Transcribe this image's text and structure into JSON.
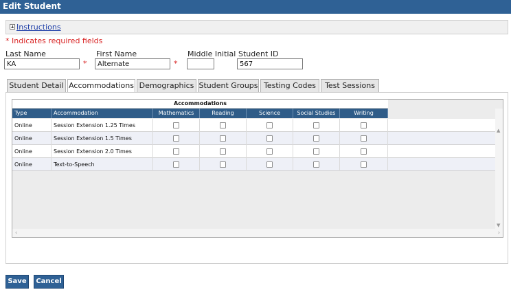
{
  "title": "Edit Student",
  "instructions": {
    "label": "Instructions"
  },
  "required_note": "* Indicates required fields",
  "fields": {
    "last_name": {
      "label": "Last Name",
      "value": "KA"
    },
    "first_name": {
      "label": "First Name",
      "value": "Alternate"
    },
    "middle_initial": {
      "label": "Middle Initial",
      "value": ""
    },
    "student_id": {
      "label": "Student ID",
      "value": "567"
    },
    "required_marker": "*"
  },
  "tabs": [
    {
      "label": "Student Detail",
      "active": false
    },
    {
      "label": "Accommodations",
      "active": true
    },
    {
      "label": "Demographics",
      "active": false
    },
    {
      "label": "Student Groups",
      "active": false
    },
    {
      "label": "Testing Codes",
      "active": false
    },
    {
      "label": "Test Sessions",
      "active": false
    }
  ],
  "grid": {
    "caption": "Accommodations",
    "columns": [
      "Type",
      "Accommodation",
      "Mathematics",
      "Reading",
      "Science",
      "Social Studies",
      "Writing"
    ],
    "rows": [
      {
        "type": "Online",
        "accommodation": "Session Extension 1.25 Times"
      },
      {
        "type": "Online",
        "accommodation": "Session Extension 1.5 Times"
      },
      {
        "type": "Online",
        "accommodation": "Session Extension 2.0 Times"
      },
      {
        "type": "Online",
        "accommodation": "Text-to-Speech"
      }
    ]
  },
  "buttons": {
    "save": "Save",
    "cancel": "Cancel"
  },
  "colors": {
    "header": "#2f6195",
    "required": "#d92525",
    "grid_header": "#2f5c88"
  }
}
